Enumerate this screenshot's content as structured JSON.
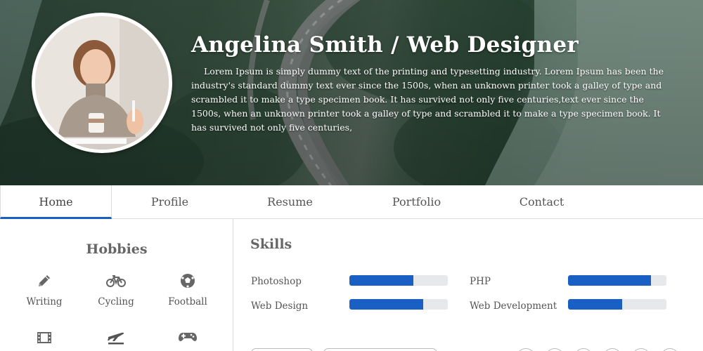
{
  "hero": {
    "title": "Angelina Smith / Web Designer",
    "bio": "Lorem Ipsum is simply dummy text of the printing and typesetting industry. Lorem Ipsum has been the industry's standard dummy text ever since the 1500s, when an unknown printer took a galley of type and scrambled it to make a type specimen book. It has survived not only five centuries,text ever since the 1500s, when an unknown printer took a galley of type and scrambled it to make a type specimen book. It has survived not only five centuries,"
  },
  "nav": {
    "items": [
      {
        "label": "Home",
        "active": true
      },
      {
        "label": "Profile"
      },
      {
        "label": "Resume"
      },
      {
        "label": "Portfolio"
      },
      {
        "label": "Contact"
      }
    ]
  },
  "hobbies": {
    "title": "Hobbies",
    "items": [
      {
        "label": "Writing",
        "icon": "pencil-icon"
      },
      {
        "label": "Cycling",
        "icon": "bicycle-icon"
      },
      {
        "label": "Football",
        "icon": "football-icon"
      },
      {
        "label": "",
        "icon": "film-icon"
      },
      {
        "label": "",
        "icon": "airplane-icon"
      },
      {
        "label": "",
        "icon": "gamepad-icon"
      }
    ]
  },
  "skills": {
    "title": "Skills",
    "items": [
      {
        "label": "Photoshop",
        "level": 0.65
      },
      {
        "label": "PHP",
        "level": 0.84
      },
      {
        "label": "Web Design",
        "level": 0.75
      },
      {
        "label": "Web Development",
        "level": 0.55
      }
    ]
  },
  "colors": {
    "accent": "#1a5fc4",
    "bar_track": "#e6e8ec",
    "divider": "#dcdcdc",
    "text": "#555555"
  }
}
